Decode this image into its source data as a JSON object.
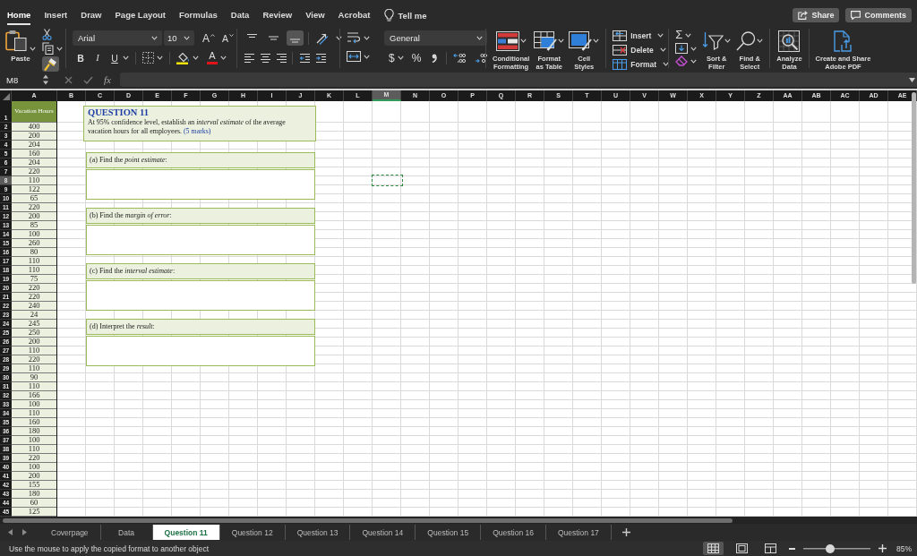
{
  "ribbon_tabs": [
    {
      "label": "Home",
      "selected": true
    },
    {
      "label": "Insert",
      "selected": false
    },
    {
      "label": "Draw",
      "selected": false
    },
    {
      "label": "Page Layout",
      "selected": false
    },
    {
      "label": "Formulas",
      "selected": false
    },
    {
      "label": "Data",
      "selected": false
    },
    {
      "label": "Review",
      "selected": false
    },
    {
      "label": "View",
      "selected": false
    },
    {
      "label": "Acrobat",
      "selected": false
    }
  ],
  "tell_me": "Tell me",
  "header_buttons": [
    {
      "kind": "share",
      "label": "Share"
    },
    {
      "kind": "comments",
      "label": "Comments"
    }
  ],
  "clipboard": {
    "paste": "Paste",
    "format_painter_on": true
  },
  "font": {
    "name": "Arial",
    "size": "10",
    "size_buttons": [
      {
        "kind": "grow",
        "label": "A"
      },
      {
        "kind": "shrink",
        "label": "A"
      }
    ],
    "style_buttons": [
      {
        "kind": "bold",
        "label": "B"
      },
      {
        "kind": "italic",
        "label": "I"
      },
      {
        "kind": "underline",
        "label": "U"
      }
    ],
    "font_color": "A"
  },
  "alignment": {
    "vertical": [
      {
        "kind": "top",
        "selected": false
      },
      {
        "kind": "middle",
        "selected": false
      },
      {
        "kind": "bottom",
        "selected": true
      }
    ]
  },
  "number": {
    "format": "General",
    "currency": "$",
    "percent": "%"
  },
  "styles": [
    {
      "kind": "conditional",
      "label": "Conditional\nFormatting"
    },
    {
      "kind": "table",
      "label": "Format\nas Table"
    },
    {
      "kind": "cell-styles",
      "label": "Cell\nStyles"
    }
  ],
  "cells": [
    {
      "kind": "insert",
      "label": "Insert"
    },
    {
      "kind": "delete",
      "label": "Delete"
    },
    {
      "kind": "format",
      "label": "Format"
    }
  ],
  "editing": {
    "autosum": "Σ",
    "buttons": [
      {
        "kind": "sort",
        "label": "Sort &\nFilter"
      },
      {
        "kind": "find",
        "label": "Find &\nSelect"
      }
    ]
  },
  "analysis": [
    {
      "kind": "analyze",
      "label": "Analyze\nData"
    },
    {
      "kind": "pdf",
      "label": "Create and Share\nAdobe PDF"
    }
  ],
  "formula_bar": {
    "name_box": "M8",
    "function_label": "fx"
  },
  "sheet": {
    "columns": [
      {
        "label": "A",
        "selected": false
      },
      {
        "label": "B",
        "selected": false
      },
      {
        "label": "C",
        "selected": false
      },
      {
        "label": "D",
        "selected": false
      },
      {
        "label": "E",
        "selected": false
      },
      {
        "label": "F",
        "selected": false
      },
      {
        "label": "G",
        "selected": false
      },
      {
        "label": "H",
        "selected": false
      },
      {
        "label": "I",
        "selected": false
      },
      {
        "label": "J",
        "selected": false
      },
      {
        "label": "K",
        "selected": false
      },
      {
        "label": "L",
        "selected": false
      },
      {
        "label": "M",
        "selected": true
      },
      {
        "label": "N",
        "selected": false
      },
      {
        "label": "O",
        "selected": false
      },
      {
        "label": "P",
        "selected": false
      },
      {
        "label": "Q",
        "selected": false
      },
      {
        "label": "R",
        "selected": false
      },
      {
        "label": "S",
        "selected": false
      },
      {
        "label": "T",
        "selected": false
      },
      {
        "label": "U",
        "selected": false
      },
      {
        "label": "V",
        "selected": false
      },
      {
        "label": "W",
        "selected": false
      },
      {
        "label": "X",
        "selected": false
      },
      {
        "label": "Y",
        "selected": false
      },
      {
        "label": "Z",
        "selected": false
      },
      {
        "label": "AA",
        "selected": false
      },
      {
        "label": "AB",
        "selected": false
      },
      {
        "label": "AC",
        "selected": false
      },
      {
        "label": "AD",
        "selected": false
      },
      {
        "label": "AE",
        "selected": false
      }
    ],
    "rows": [
      {
        "number": "1",
        "selected": false,
        "kind": "header",
        "cell": "Vacation Hours"
      },
      {
        "number": "2",
        "selected": false,
        "kind": "value",
        "cell": "400"
      },
      {
        "number": "3",
        "selected": false,
        "kind": "value",
        "cell": "200"
      },
      {
        "number": "4",
        "selected": false,
        "kind": "value",
        "cell": "204"
      },
      {
        "number": "5",
        "selected": false,
        "kind": "value",
        "cell": "160"
      },
      {
        "number": "6",
        "selected": false,
        "kind": "value",
        "cell": "204"
      },
      {
        "number": "7",
        "selected": false,
        "kind": "value",
        "cell": "220"
      },
      {
        "number": "8",
        "selected": true,
        "kind": "value",
        "cell": "110"
      },
      {
        "number": "9",
        "selected": false,
        "kind": "value",
        "cell": "122"
      },
      {
        "number": "10",
        "selected": false,
        "kind": "value",
        "cell": "65"
      },
      {
        "number": "11",
        "selected": false,
        "kind": "value",
        "cell": "220"
      },
      {
        "number": "12",
        "selected": false,
        "kind": "value",
        "cell": "200"
      },
      {
        "number": "13",
        "selected": false,
        "kind": "value",
        "cell": "85"
      },
      {
        "number": "14",
        "selected": false,
        "kind": "value",
        "cell": "100"
      },
      {
        "number": "15",
        "selected": false,
        "kind": "value",
        "cell": "260"
      },
      {
        "number": "16",
        "selected": false,
        "kind": "value",
        "cell": "80"
      },
      {
        "number": "17",
        "selected": false,
        "kind": "value",
        "cell": "110"
      },
      {
        "number": "18",
        "selected": false,
        "kind": "value",
        "cell": "110"
      },
      {
        "number": "19",
        "selected": false,
        "kind": "value",
        "cell": "75"
      },
      {
        "number": "20",
        "selected": false,
        "kind": "value",
        "cell": "220"
      },
      {
        "number": "21",
        "selected": false,
        "kind": "value",
        "cell": "220"
      },
      {
        "number": "22",
        "selected": false,
        "kind": "value",
        "cell": "240"
      },
      {
        "number": "23",
        "selected": false,
        "kind": "value",
        "cell": "24"
      },
      {
        "number": "24",
        "selected": false,
        "kind": "value",
        "cell": "245"
      },
      {
        "number": "25",
        "selected": false,
        "kind": "value",
        "cell": "250"
      },
      {
        "number": "26",
        "selected": false,
        "kind": "value",
        "cell": "200"
      },
      {
        "number": "27",
        "selected": false,
        "kind": "value",
        "cell": "110"
      },
      {
        "number": "28",
        "selected": false,
        "kind": "value",
        "cell": "220"
      },
      {
        "number": "29",
        "selected": false,
        "kind": "value",
        "cell": "110"
      },
      {
        "number": "30",
        "selected": false,
        "kind": "value",
        "cell": "90"
      },
      {
        "number": "31",
        "selected": false,
        "kind": "value",
        "cell": "110"
      },
      {
        "number": "32",
        "selected": false,
        "kind": "value",
        "cell": "166"
      },
      {
        "number": "33",
        "selected": false,
        "kind": "value",
        "cell": "100"
      },
      {
        "number": "34",
        "selected": false,
        "kind": "value",
        "cell": "110"
      },
      {
        "number": "35",
        "selected": false,
        "kind": "value",
        "cell": "160"
      },
      {
        "number": "36",
        "selected": false,
        "kind": "value",
        "cell": "180"
      },
      {
        "number": "37",
        "selected": false,
        "kind": "value",
        "cell": "100"
      },
      {
        "number": "38",
        "selected": false,
        "kind": "value",
        "cell": "110"
      },
      {
        "number": "39",
        "selected": false,
        "kind": "value",
        "cell": "220"
      },
      {
        "number": "40",
        "selected": false,
        "kind": "value",
        "cell": "100"
      },
      {
        "number": "41",
        "selected": false,
        "kind": "value",
        "cell": "200"
      },
      {
        "number": "42",
        "selected": false,
        "kind": "value",
        "cell": "155"
      },
      {
        "number": "43",
        "selected": false,
        "kind": "value",
        "cell": "180"
      },
      {
        "number": "44",
        "selected": false,
        "kind": "value",
        "cell": "60"
      },
      {
        "number": "45",
        "selected": false,
        "kind": "value",
        "cell": "125"
      }
    ]
  },
  "question": {
    "title": "QUESTION 11",
    "text": "At 95% confidence level, establish an *interval estimate* of the average vacation hours for all employees.",
    "marks": "(5 marks)",
    "parts": [
      {
        "label": "(a) Find the *point estimate*:"
      },
      {
        "label": "(b) Find the *margin of error*:"
      },
      {
        "label": "(c) Find the *interval estimate*:"
      },
      {
        "label": "(d) Interpret the *result*:"
      }
    ]
  },
  "sheet_tabs": [
    {
      "label": "Coverpage",
      "selected": false
    },
    {
      "label": "Data",
      "selected": false
    },
    {
      "label": "Question 11",
      "selected": true
    },
    {
      "label": "Question 12",
      "selected": false
    },
    {
      "label": "Question 13",
      "selected": false
    },
    {
      "label": "Question 14",
      "selected": false
    },
    {
      "label": "Question 15",
      "selected": false
    },
    {
      "label": "Question 16",
      "selected": false
    },
    {
      "label": "Question 17",
      "selected": false
    }
  ],
  "status_bar": {
    "message": "Use the mouse to apply the copied format to another object",
    "views": [
      {
        "kind": "normal",
        "selected": true
      },
      {
        "kind": "page-layout",
        "selected": false
      },
      {
        "kind": "page-break",
        "selected": false
      }
    ],
    "zoom": {
      "level": 0.4,
      "percent": "85%"
    }
  }
}
